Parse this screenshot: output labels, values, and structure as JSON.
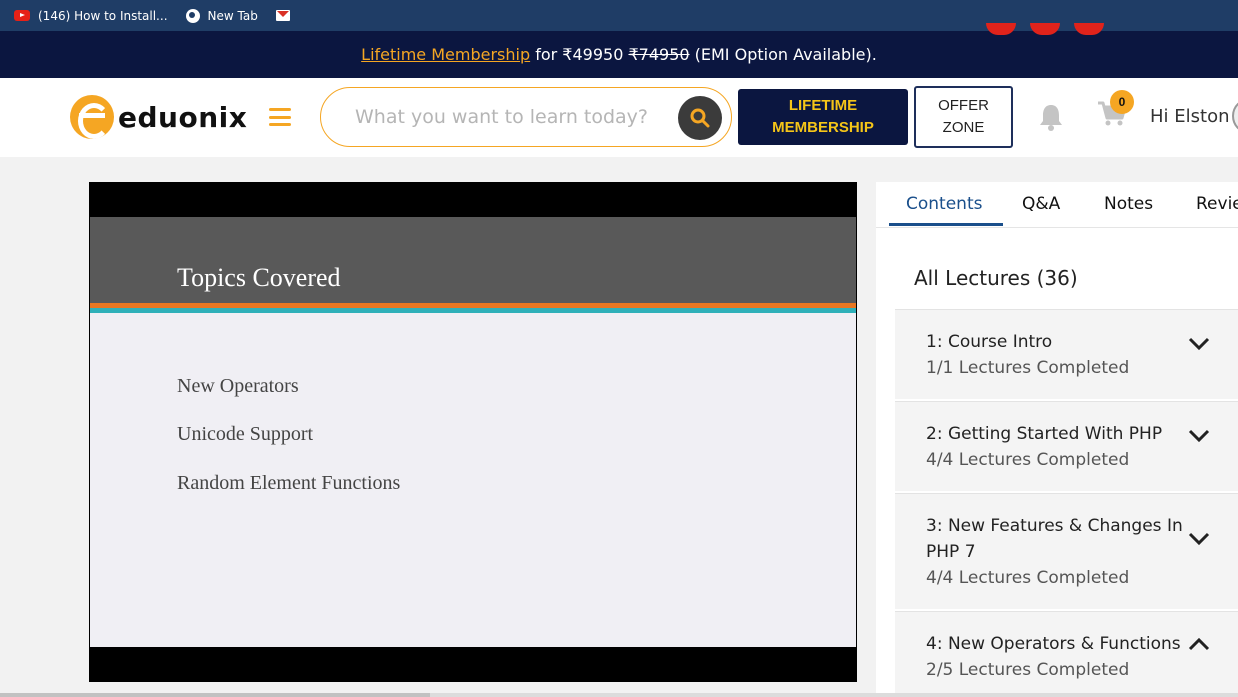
{
  "bookmarks": [
    {
      "label": "(146) How to Install...",
      "icon": "youtube-icon"
    },
    {
      "label": "New Tab",
      "icon": "globe-icon"
    },
    {
      "label": "",
      "icon": "gmail-icon"
    }
  ],
  "promo": {
    "link": "Lifetime Membership",
    "text_for": " for ",
    "price": "₹49950",
    "old_price": "₹74950",
    "tail": " (EMI Option Available)."
  },
  "header": {
    "logo": "eduonix",
    "search_placeholder": "What you want to learn today?",
    "lifetime_btn": "LIFETIME MEMBERSHIP",
    "offer_btn": "OFFER ZONE",
    "cart_count": "0",
    "greeting": "Hi Elston"
  },
  "slide": {
    "title": "Topics Covered",
    "bullets": [
      "New Operators",
      "Unicode Support",
      "Random Element Functions"
    ]
  },
  "panel": {
    "tabs": [
      "Contents",
      "Q&A",
      "Notes",
      "Reviews"
    ],
    "active_tab": "Contents",
    "heading": "All Lectures (36)",
    "sections": [
      {
        "title": "1: Course Intro",
        "sub": "1/1 Lectures Completed",
        "expanded": false
      },
      {
        "title": "2: Getting Started With PHP",
        "sub": "4/4 Lectures Completed",
        "expanded": false
      },
      {
        "title": "3: New Features & Changes In PHP 7",
        "sub": "4/4 Lectures Completed",
        "expanded": false
      },
      {
        "title": "4: New Operators & Functions",
        "sub": "2/5 Lectures Completed",
        "expanded": true
      }
    ]
  },
  "colors": {
    "accent": "#f5a623",
    "navy": "#0b1640",
    "tab_active": "#1a4f8b"
  }
}
